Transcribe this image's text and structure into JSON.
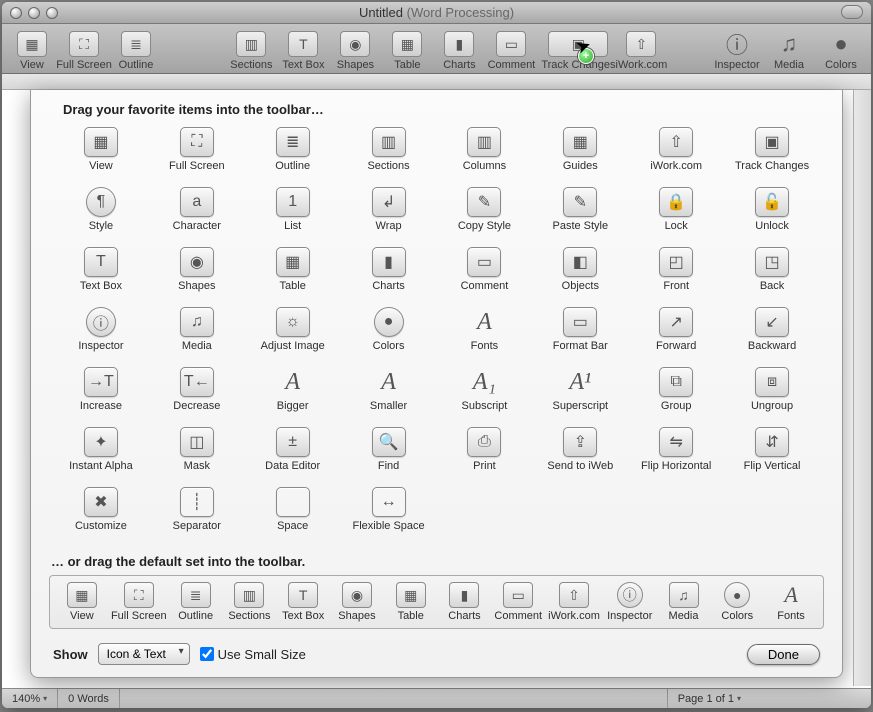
{
  "window": {
    "title": "Untitled",
    "subtitle": "(Word Processing)"
  },
  "toolbar": {
    "items_left": [
      {
        "label": "View",
        "icon": "▦"
      },
      {
        "label": "Full Screen",
        "icon": "⛶"
      },
      {
        "label": "Outline",
        "icon": "≣"
      }
    ],
    "items_mid": [
      {
        "label": "Sections",
        "icon": "▥"
      },
      {
        "label": "Text Box",
        "icon": "T"
      },
      {
        "label": "Shapes",
        "icon": "◉"
      },
      {
        "label": "Table",
        "icon": "▦"
      },
      {
        "label": "Charts",
        "icon": "▮"
      },
      {
        "label": "Comment",
        "icon": "▭"
      }
    ],
    "track_label": "Track Changes",
    "iwork_label": "iWork.com",
    "items_right": [
      {
        "label": "Inspector",
        "icon": "ⓘ"
      },
      {
        "label": "Media",
        "icon": "♫"
      },
      {
        "label": "Colors",
        "icon": "●"
      }
    ]
  },
  "sheet": {
    "heading": "Drag your favorite items into the toolbar…",
    "palette": [
      {
        "label": "View",
        "icon": "▦"
      },
      {
        "label": "Full Screen",
        "icon": "⛶"
      },
      {
        "label": "Outline",
        "icon": "≣"
      },
      {
        "label": "Sections",
        "icon": "▥"
      },
      {
        "label": "Columns",
        "icon": "▥"
      },
      {
        "label": "Guides",
        "icon": "▦"
      },
      {
        "label": "iWork.com",
        "icon": "⇧"
      },
      {
        "label": "Track Changes",
        "icon": "▣"
      },
      {
        "label": "Style",
        "icon": "¶",
        "round": true
      },
      {
        "label": "Character",
        "icon": "a"
      },
      {
        "label": "List",
        "icon": "1"
      },
      {
        "label": "Wrap",
        "icon": "↲"
      },
      {
        "label": "Copy Style",
        "icon": "✎"
      },
      {
        "label": "Paste Style",
        "icon": "✎"
      },
      {
        "label": "Lock",
        "icon": "🔒"
      },
      {
        "label": "Unlock",
        "icon": "🔓"
      },
      {
        "label": "Text Box",
        "icon": "T"
      },
      {
        "label": "Shapes",
        "icon": "◉"
      },
      {
        "label": "Table",
        "icon": "▦"
      },
      {
        "label": "Charts",
        "icon": "▮"
      },
      {
        "label": "Comment",
        "icon": "▭"
      },
      {
        "label": "Objects",
        "icon": "◧"
      },
      {
        "label": "Front",
        "icon": "◰"
      },
      {
        "label": "Back",
        "icon": "◳"
      },
      {
        "label": "Inspector",
        "icon": "ⓘ",
        "round": true
      },
      {
        "label": "Media",
        "icon": "♫"
      },
      {
        "label": "Adjust Image",
        "icon": "☼"
      },
      {
        "label": "Colors",
        "icon": "●",
        "round": true
      },
      {
        "label": "Fonts",
        "icon": "A",
        "plain": true
      },
      {
        "label": "Format Bar",
        "icon": "▭"
      },
      {
        "label": "Forward",
        "icon": "↗"
      },
      {
        "label": "Backward",
        "icon": "↙"
      },
      {
        "label": "Increase",
        "icon": "→T"
      },
      {
        "label": "Decrease",
        "icon": "T←"
      },
      {
        "label": "Bigger",
        "icon": "A",
        "plain": true
      },
      {
        "label": "Smaller",
        "icon": "A",
        "plain": true
      },
      {
        "label": "Subscript",
        "icon": "A₁",
        "plain": true
      },
      {
        "label": "Superscript",
        "icon": "A¹",
        "plain": true
      },
      {
        "label": "Group",
        "icon": "⧉"
      },
      {
        "label": "Ungroup",
        "icon": "⧈"
      },
      {
        "label": "Instant Alpha",
        "icon": "✦"
      },
      {
        "label": "Mask",
        "icon": "◫"
      },
      {
        "label": "Data Editor",
        "icon": "±"
      },
      {
        "label": "Find",
        "icon": "🔍"
      },
      {
        "label": "Print",
        "icon": "⎙"
      },
      {
        "label": "Send to iWeb",
        "icon": "⇪"
      },
      {
        "label": "Flip Horizontal",
        "icon": "⇋"
      },
      {
        "label": "Flip Vertical",
        "icon": "⇵"
      },
      {
        "label": "Customize",
        "icon": "✖"
      },
      {
        "label": "Separator",
        "icon": "┊",
        "box": true
      },
      {
        "label": "Space",
        "icon": "",
        "box": true
      },
      {
        "label": "Flexible Space",
        "icon": "↔",
        "box": true
      }
    ],
    "subheading": "… or drag the default set into the toolbar.",
    "default_set": [
      {
        "label": "View",
        "icon": "▦"
      },
      {
        "label": "Full Screen",
        "icon": "⛶"
      },
      {
        "label": "Outline",
        "icon": "≣"
      },
      {
        "label": "Sections",
        "icon": "▥"
      },
      {
        "label": "Text Box",
        "icon": "T"
      },
      {
        "label": "Shapes",
        "icon": "◉"
      },
      {
        "label": "Table",
        "icon": "▦"
      },
      {
        "label": "Charts",
        "icon": "▮"
      },
      {
        "label": "Comment",
        "icon": "▭"
      },
      {
        "label": "iWork.com",
        "icon": "⇧"
      },
      {
        "label": "Inspector",
        "icon": "ⓘ",
        "round": true
      },
      {
        "label": "Media",
        "icon": "♫"
      },
      {
        "label": "Colors",
        "icon": "●",
        "round": true
      },
      {
        "label": "Fonts",
        "icon": "A",
        "plain": true
      }
    ],
    "show_label": "Show",
    "show_value": "Icon & Text",
    "small_size_label": "Use Small Size",
    "small_size_checked": true,
    "done_label": "Done"
  },
  "statusbar": {
    "zoom": "140%",
    "words": "0 Words",
    "page": "Page 1 of 1"
  },
  "cursor_badge": "+"
}
